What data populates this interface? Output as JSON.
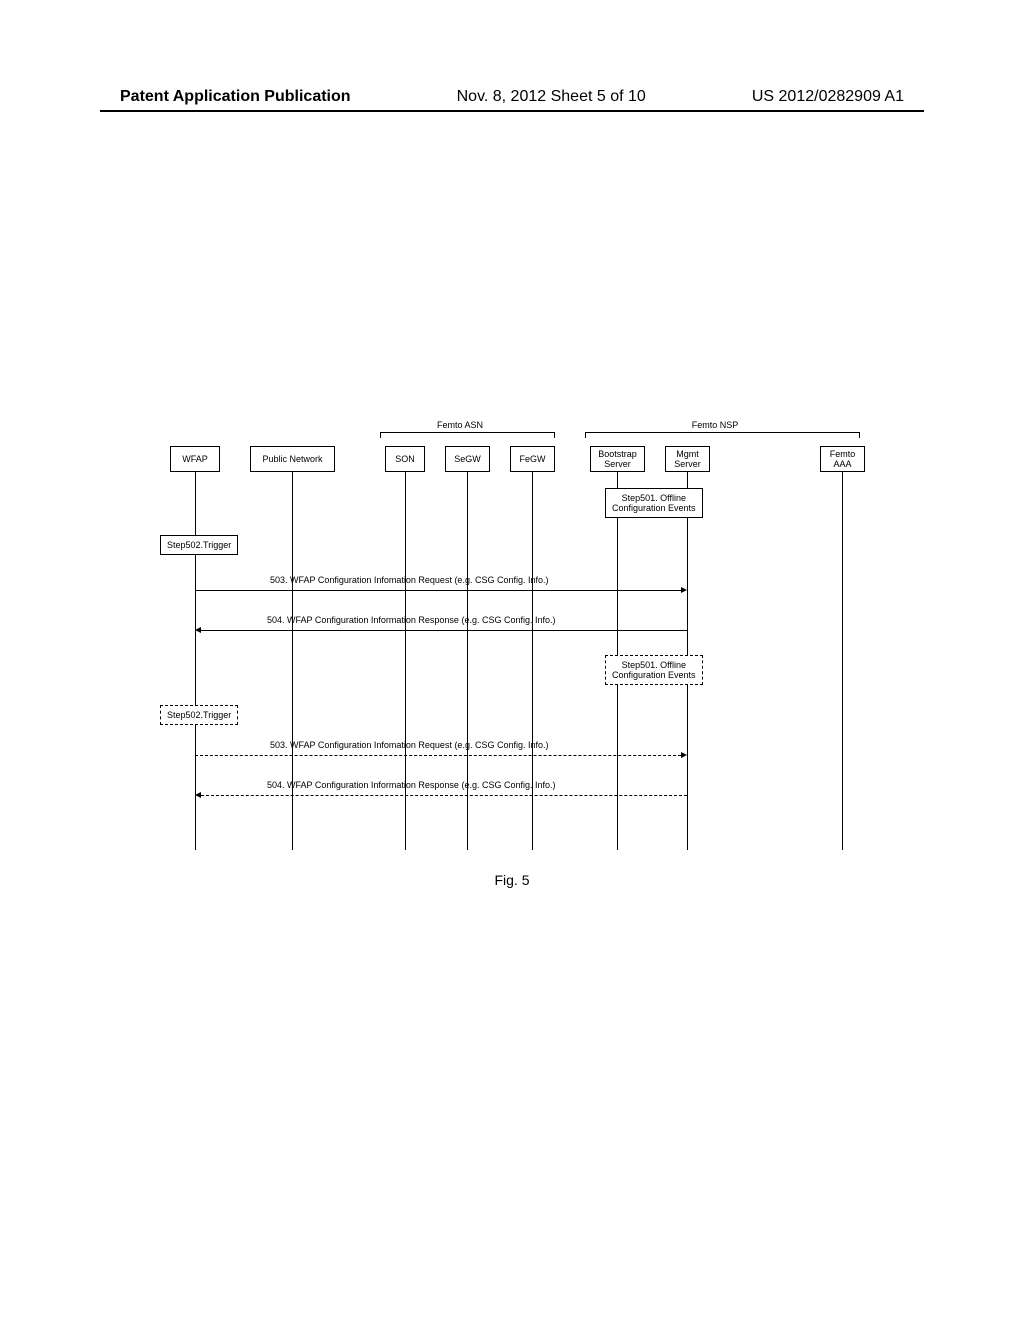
{
  "header": {
    "left": "Patent Application Publication",
    "center": "Nov. 8, 2012  Sheet 5 of 10",
    "right": "US 2012/0282909 A1"
  },
  "groups": {
    "asn": "Femto ASN",
    "nsp": "Femto NSP"
  },
  "entities": {
    "wfap": "WFAP",
    "public_network": "Public Network",
    "son": "SON",
    "segw": "SeGW",
    "fegw": "FeGW",
    "bootstrap": "Bootstrap\nServer",
    "mgmt": "Mgmt\nServer",
    "aaa": "Femto\nAAA"
  },
  "steps": {
    "step501": "Step501. Offline\nConfiguration Events",
    "step502": "Step502.Trigger"
  },
  "messages": {
    "msg503": "503. WFAP Configuration Infomation Request (e.g. CSG Config. Info.)",
    "msg504": "504. WFAP Configuration Information Response (e.g. CSG Config. Info.)"
  },
  "figure": "Fig. 5"
}
